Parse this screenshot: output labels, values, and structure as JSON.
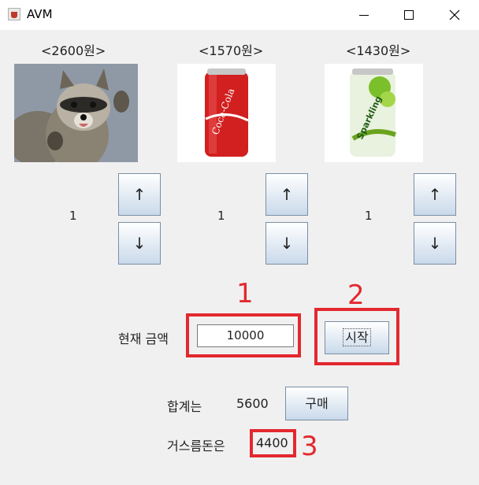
{
  "window": {
    "title": "AVM"
  },
  "products": [
    {
      "price_label": "<2600원>",
      "image": "raccoon",
      "quantity": "1"
    },
    {
      "price_label": "<1570원>",
      "image": "coca-cola-can",
      "quantity": "1"
    },
    {
      "price_label": "<1430원>",
      "image": "tropicana-sparkling-can",
      "quantity": "1"
    }
  ],
  "buttons": {
    "up": "↑",
    "down": "↓",
    "start": "시작",
    "buy": "구매"
  },
  "money": {
    "label": "현재 금액",
    "value": "10000"
  },
  "summary": {
    "total_label": "합계는",
    "total_value": "5600",
    "change_label": "거스름돈은",
    "change_value": "4400"
  },
  "annotations": {
    "one": "1",
    "two": "2",
    "three": "3",
    "color": "#e3282f"
  }
}
